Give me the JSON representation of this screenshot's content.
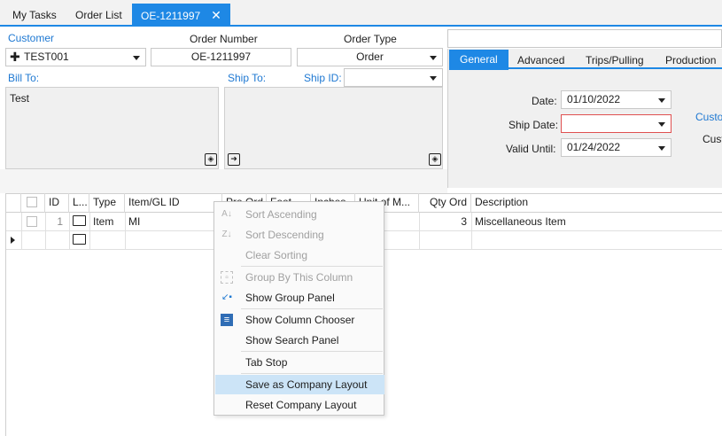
{
  "tabs": [
    {
      "label": "My Tasks"
    },
    {
      "label": "Order List"
    },
    {
      "label": "OE-1211997",
      "close": "✕"
    }
  ],
  "customer": {
    "label": "Customer",
    "value": "TEST001"
  },
  "order_number": {
    "label": "Order Number",
    "value": "OE-1211997"
  },
  "order_type": {
    "label": "Order Type",
    "value": "Order"
  },
  "bill_to": {
    "label": "Bill To:",
    "value": "Test"
  },
  "ship_to": {
    "label": "Ship To:"
  },
  "ship_id": {
    "label": "Ship ID:",
    "value": ""
  },
  "right_tabs": [
    "General",
    "Advanced",
    "Trips/Pulling",
    "Production"
  ],
  "general": {
    "date_label": "Date:",
    "date_value": "01/10/2022",
    "ship_date_label": "Ship Date:",
    "ship_date_value": "",
    "valid_until_label": "Valid Until:",
    "valid_until_value": "01/24/2022",
    "custo_link": "Custo",
    "cust_label": "Cust"
  },
  "grid": {
    "columns": [
      "",
      "ID",
      "L...",
      "Type",
      "Item/GL ID",
      "Pre Ord",
      "Feet",
      "Inches",
      "Unit of M...",
      "Qty Ord",
      "Description"
    ],
    "rows": [
      {
        "id": "1",
        "type": "Item",
        "item": "MI",
        "qty": "3",
        "description": "Miscellaneous Item"
      }
    ]
  },
  "context_menu": {
    "items": [
      {
        "label": "Sort Ascending",
        "disabled": true,
        "icon": "sort-ascending-icon"
      },
      {
        "label": "Sort Descending",
        "disabled": true,
        "icon": "sort-descending-icon"
      },
      {
        "label": "Clear Sorting",
        "disabled": true
      },
      {
        "label": "Group By This Column",
        "disabled": true,
        "icon": "group-icon"
      },
      {
        "label": "Show Group Panel",
        "disabled": false,
        "icon": "group-panel-icon"
      },
      {
        "label": "Show Column Chooser",
        "disabled": false,
        "icon": "column-chooser-icon"
      },
      {
        "label": "Show Search Panel",
        "disabled": false
      },
      {
        "label": "Tab Stop",
        "disabled": false
      },
      {
        "label": "Save as Company Layout",
        "disabled": false,
        "highlighted": true
      },
      {
        "label": "Reset Company Layout",
        "disabled": false
      }
    ]
  },
  "colors": {
    "accent": "#1e88e5",
    "highlight": "#cce4f7",
    "error_border": "#e05050"
  }
}
